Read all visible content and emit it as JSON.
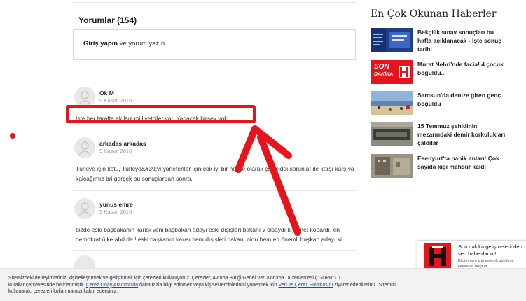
{
  "comments": {
    "heading": "Yorumlar (154)",
    "login": {
      "link": "Giriş yapın",
      "rest": " ve yorum yazın"
    },
    "items": [
      {
        "name": "Ok M",
        "date": "9 Kasım 2016",
        "text": "İşte her tarafta akılsız milliyetçiler var. Yapacak birşey yok."
      },
      {
        "name": "arkadas arkadas",
        "date": "9 Kasım 2016",
        "text": "Türkiye için kötü, Türkiye&#39;yi yönetenler için çok iyi bir netice olarak çok ciddi sorunlar ile karşı karşıya kalcağımız bri gerçek bu sonuçlardan sonra."
      },
      {
        "name": "yunus emre",
        "date": "9 Kasım 2016",
        "text": "bizde eski başbakanın karısı yeni başbakan adayı eski dışişleri bakanı v olsaydı kıyamet kopardı. en demokrat ülke abd de ! eski başkanın karısı hem dışişleri bakanı oldu hem en önemli başkan adayı ki"
      }
    ]
  },
  "sidebar": {
    "title": "En Çok Okunan Haberler",
    "news": [
      {
        "title": "Bekçilik sınav sonuçları bu hafta açıklanacak - İşte sonuç tarihi",
        "thumb": "exam"
      },
      {
        "title": "Murat Nehri'nde facia! 4 çocuk boğuldu...",
        "thumb": "son-dakika"
      },
      {
        "title": "Samsun'da denize giren genç boğuldu",
        "thumb": "beach"
      },
      {
        "title": "15 Temmuz şehidinin mezarındaki demir korkulukları çaldılar",
        "thumb": "grave"
      },
      {
        "title": "Esenyurt'ta panik anları! Çok sayıda kişi mahsur kaldı",
        "thumb": "building"
      }
    ],
    "thumb_son_dakika": {
      "line1": "SON",
      "line2": "DAKİKA"
    }
  },
  "notification": {
    "title_line1": "Son dakika gelişmelerinden",
    "title_line2": "sen haberdar ol!",
    "sub_line1": "Bildirimlere izin vererek gündemi",
    "sub_line2": "yakından takip et"
  },
  "cookie": {
    "line1": "Sitemizdeki deneyimlerinizi kişiselleştirmek ve geliştirmek için çerezleri kullanıyoruz. Çerezler, Avrupa Birliği Genel Veri Koruma Düzenlemesi (\"GDPR\") u",
    "line2_pre": "kurallar çerçevesinde belirlenmiştir. ",
    "link1": "Çerez Onay Aracımızda",
    "line2_mid": " daha fazla bilgi edinmek veya kişisel tercihlerinizi yönetmek için ",
    "link2": "Veri ve Çerez Politikasını",
    "line2_post": " ziyaret edebilirsiniz. Sitemizi",
    "line3": "kullanarak, çerezleri kullanmamızı kabul edersiniz."
  },
  "colors": {
    "accent": "#e8141c",
    "link": "#1a4f99"
  }
}
